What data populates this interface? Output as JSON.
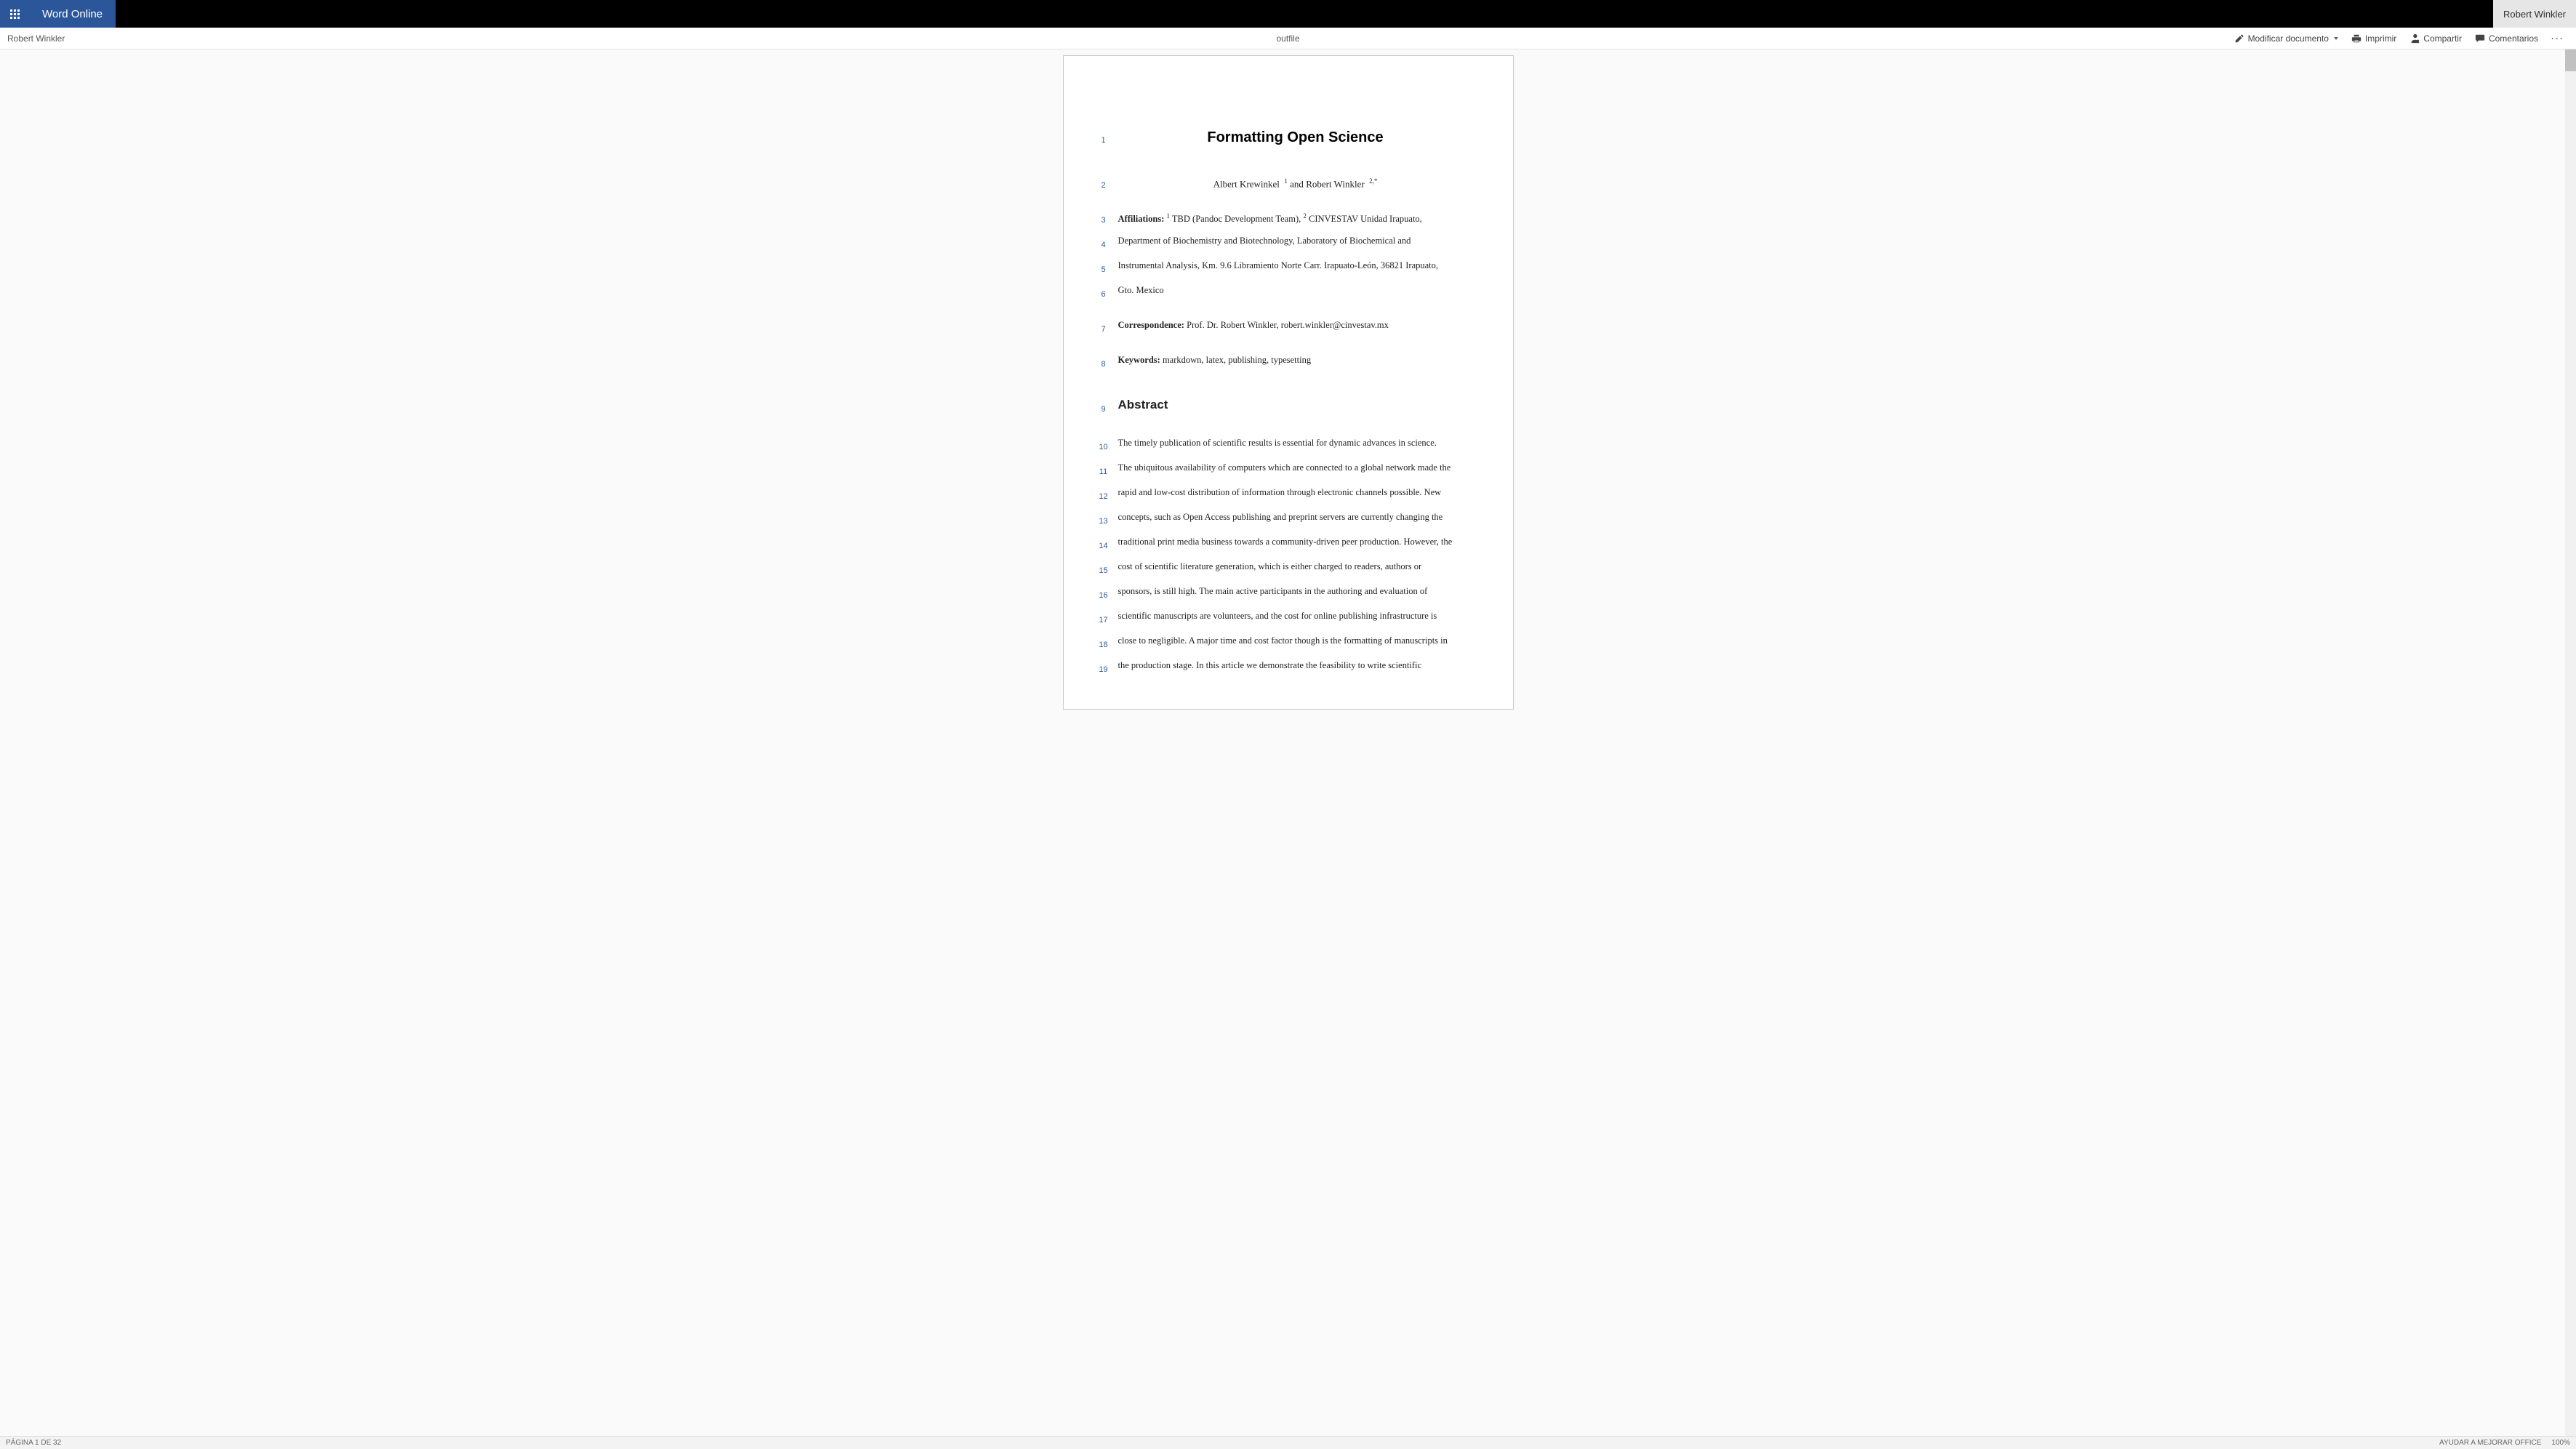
{
  "header": {
    "app_name": "Word Online",
    "signed_in_user": "Robert Winkler"
  },
  "toolbar": {
    "author_name": "Robert Winkler",
    "doc_name": "outfile",
    "edit_label": "Modificar documento",
    "print_label": "Imprimir",
    "share_label": "Compartir",
    "comments_label": "Comentarios"
  },
  "document": {
    "lines": {
      "1": {
        "num": "1",
        "text": "Formatting Open Science"
      },
      "2": {
        "num": "2",
        "author1": "Albert Krewinkel",
        "sup1": "1",
        "conj": " and ",
        "author2": "Robert Winkler",
        "sup2": "2,*"
      },
      "3": {
        "num": "3",
        "label": "Affiliations:",
        "sup1": "1",
        "part1": " TBD (Pandoc Development Team), ",
        "sup2": "2",
        "part2": " CINVESTAV Unidad Irapuato,"
      },
      "4": {
        "num": "4",
        "text": "Department of Biochemistry and Biotechnology, Laboratory of Biochemical and"
      },
      "5": {
        "num": "5",
        "text": "Instrumental Analysis, Km. 9.6 Libramiento Norte Carr. Irapuato-León, 36821 Irapuato,"
      },
      "6": {
        "num": "6",
        "text": "Gto. Mexico"
      },
      "7": {
        "num": "7",
        "label": "Correspondence:",
        "text": " Prof. Dr. Robert Winkler, robert.winkler@cinvestav.mx"
      },
      "8": {
        "num": "8",
        "label": "Keywords:",
        "text": " markdown, latex, publishing, typesetting"
      },
      "9": {
        "num": "9",
        "text": "Abstract"
      },
      "10": {
        "num": "10",
        "text": "The timely publication of scientific results is essential for dynamic advances in science."
      },
      "11": {
        "num": "11",
        "text": "The ubiquitous availability of computers which are connected to a global network made the"
      },
      "12": {
        "num": "12",
        "text": "rapid and low-cost distribution of information through electronic channels possible. New"
      },
      "13": {
        "num": "13",
        "text": "concepts, such as Open Access publishing and preprint servers are currently changing the"
      },
      "14": {
        "num": "14",
        "text": "traditional print media business towards a community-driven peer production. However, the"
      },
      "15": {
        "num": "15",
        "text": "cost of scientific literature generation, which is either charged to readers, authors or"
      },
      "16": {
        "num": "16",
        "text": "sponsors, is still high. The main active participants in the authoring and evaluation of"
      },
      "17": {
        "num": "17",
        "text": "scientific manuscripts are volunteers, and the cost for online publishing infrastructure is"
      },
      "18": {
        "num": "18",
        "text": "close to negligible. A major time and cost factor though is the formatting of manuscripts in"
      },
      "19": {
        "num": "19",
        "text": "the production stage. In this article we demonstrate the feasibility to write scientific"
      }
    }
  },
  "status": {
    "page_info": "PÁGINA 1 DE 32",
    "help_label": "AYUDAR A MEJORAR OFFICE",
    "zoom": "100%"
  }
}
